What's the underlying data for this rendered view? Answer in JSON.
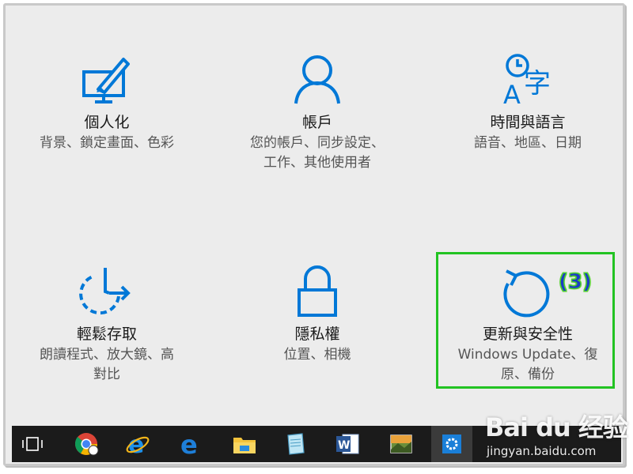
{
  "tiles": [
    {
      "title": "個人化",
      "desc": [
        "背景、鎖定畫面、色彩"
      ],
      "icon": "personalization-icon"
    },
    {
      "title": "帳戶",
      "desc": [
        "您的帳戶、同步設定、",
        "工作、其他使用者"
      ],
      "icon": "account-icon"
    },
    {
      "title": "時間與語言",
      "desc": [
        "語音、地區、日期"
      ],
      "icon": "time-language-icon"
    },
    {
      "title": "輕鬆存取",
      "desc": [
        "朗讀程式、放大鏡、高",
        "對比"
      ],
      "icon": "ease-of-access-icon"
    },
    {
      "title": "隱私權",
      "desc": [
        "位置、相機"
      ],
      "icon": "privacy-lock-icon"
    },
    {
      "title": "更新與安全性",
      "desc": [
        "Windows Update、復",
        "原、備份"
      ],
      "icon": "update-refresh-icon"
    }
  ],
  "annotation": {
    "step_label": "(3)"
  },
  "taskbar": {
    "items": [
      "task-view-icon",
      "chrome-icon",
      "internet-explorer-icon",
      "edge-icon",
      "file-explorer-icon",
      "notepad-icon",
      "word-icon",
      "photos-icon",
      "settings-gear-icon"
    ],
    "active": "settings-gear-icon"
  },
  "watermark": {
    "logo": "Bai du 经验",
    "url": "jingyan.baidu.com"
  },
  "colors": {
    "accent": "#0078d7",
    "highlight_border": "#22c322",
    "badge": "#1a3cc8"
  }
}
